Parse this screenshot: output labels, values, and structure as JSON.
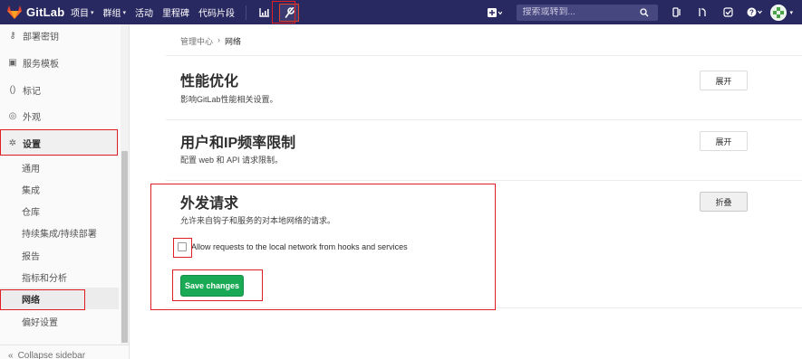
{
  "navbar": {
    "brand": "GitLab",
    "items": [
      {
        "label": "项目",
        "caret": "▾"
      },
      {
        "label": "群组",
        "caret": "▾"
      },
      {
        "label": "活动"
      },
      {
        "label": "里程碑"
      },
      {
        "label": "代码片段"
      }
    ],
    "search_placeholder": "搜索或转到...",
    "icons": [
      "chart-icon",
      "admin-wrench-icon",
      "plus-icon",
      "search-icon",
      "todo-icon",
      "merge-request-icon",
      "issues-icon",
      "help-icon",
      "user-avatar"
    ]
  },
  "sidebar": {
    "items": [
      {
        "label": "部署密钥",
        "icon": "key-icon"
      },
      {
        "label": "服务模板",
        "icon": "template-icon"
      },
      {
        "label": "标记",
        "icon": "labels-icon"
      },
      {
        "label": "外观",
        "icon": "appearance-icon"
      },
      {
        "label": "设置",
        "icon": "gear-icon"
      }
    ],
    "sub_items": [
      {
        "label": "通用"
      },
      {
        "label": "集成"
      },
      {
        "label": "仓库"
      },
      {
        "label": "持续集成/持续部署"
      },
      {
        "label": "报告"
      },
      {
        "label": "指标和分析"
      },
      {
        "label": "网络"
      },
      {
        "label": "偏好设置"
      }
    ],
    "collapse_label": "Collapse sidebar"
  },
  "main": {
    "breadcrumb": {
      "parent": "管理中心",
      "separator": "›",
      "current": "网络"
    },
    "sections": [
      {
        "title": "性能优化",
        "description": "影响GitLab性能相关设置。",
        "button": "展开"
      },
      {
        "title": "用户和IP频率限制",
        "description": "配置 web 和 API 请求限制。",
        "button": "展开"
      },
      {
        "title": "外发请求",
        "description": "允许来自钩子和服务的对本地网络的请求。",
        "button": "折叠"
      }
    ],
    "checkbox_label": "Allow requests to the local network from hooks and services",
    "save_label": "Save changes"
  },
  "colors": {
    "navbar": "#292961",
    "save": "#1aaa55",
    "annotation": "#e21d24"
  }
}
